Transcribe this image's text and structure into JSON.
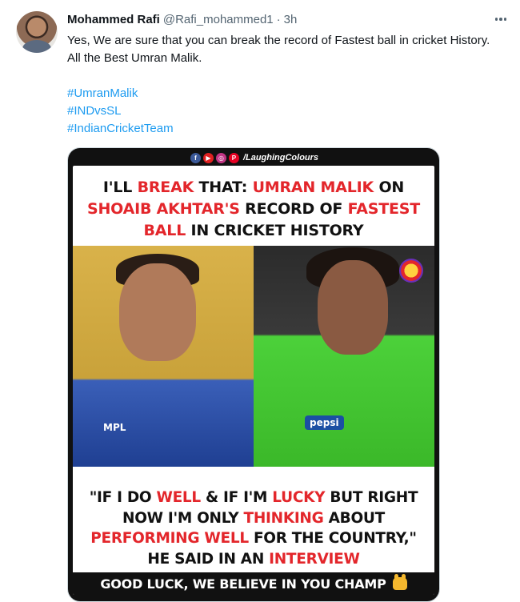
{
  "tweet": {
    "author_name": "Mohammed Rafi",
    "author_handle": "@Rafi_mohammed1",
    "separator": "·",
    "timestamp": "3h",
    "text": "Yes, We are sure that you can break the record of Fastest ball in cricket History. All the Best Umran Malik.",
    "hashtags": [
      "#UmranMalik",
      "#INDvsSL",
      "#IndianCricketTeam"
    ]
  },
  "media": {
    "brand_handle": "/LaughingColours",
    "social_icons": [
      "facebook-icon",
      "youtube-icon",
      "instagram-icon",
      "pinterest-icon"
    ],
    "headline": {
      "line1": [
        "I'LL ",
        "BREAK",
        " THAT: ",
        "UMRAN MALIK",
        " ON"
      ],
      "line2": [
        "SHOAIB AKHTAR'S",
        " RECORD OF ",
        "FASTEST"
      ],
      "line3": [
        "BALL",
        " IN CRICKET HISTORY"
      ]
    },
    "jersey_left": "MPL",
    "jersey_right": "pepsi",
    "quote": {
      "line1": [
        "\"IF I DO ",
        "WELL",
        " & IF I'M ",
        "LUCKY",
        " BUT RIGHT"
      ],
      "line2": [
        "NOW I'M ONLY ",
        "THINKING",
        " ABOUT"
      ],
      "line3": [
        "PERFORMING WELL",
        " FOR THE COUNTRY,\""
      ],
      "line4": [
        "HE SAID IN AN ",
        "INTERVIEW"
      ]
    },
    "footer": "GOOD LUCK, WE BELIEVE IN YOU CHAMP",
    "colors": {
      "accent_red": "#e3262b",
      "link_blue": "#1d9bf0"
    }
  }
}
